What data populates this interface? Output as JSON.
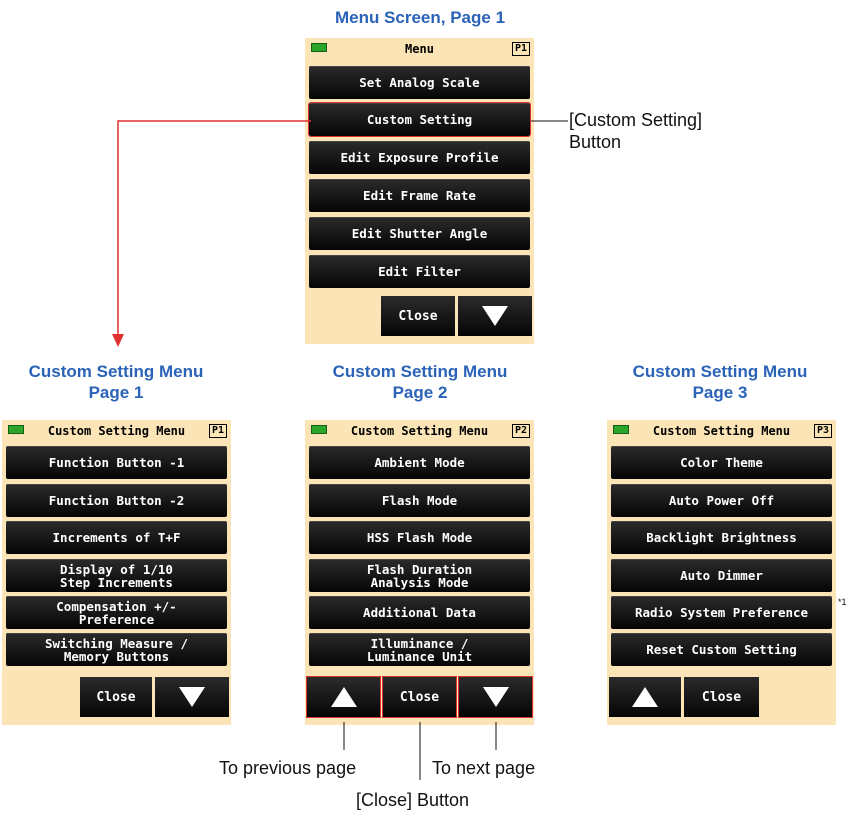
{
  "headings": {
    "menu_page1": "Menu Screen, Page 1",
    "cs_page1": [
      "Custom Setting Menu",
      "Page 1"
    ],
    "cs_page2": [
      "Custom Setting Menu",
      "Page 2"
    ],
    "cs_page3": [
      "Custom Setting Menu",
      "Page 3"
    ]
  },
  "menu_screen": {
    "title": "Menu",
    "page": "P1",
    "buttons": [
      "Set Analog Scale",
      "Custom Setting",
      "Edit Exposure Profile",
      "Edit Frame Rate",
      "Edit Shutter Angle",
      "Edit Filter"
    ],
    "close": "Close"
  },
  "cs1": {
    "title": "Custom Setting Menu",
    "page": "P1",
    "buttons": [
      "Function Button -1",
      "Function Button -2",
      "Increments of T+F",
      "Display of 1/10\nStep Increments",
      "Compensation +/-\nPreference",
      "Switching Measure /\nMemory Buttons"
    ],
    "close": "Close"
  },
  "cs2": {
    "title": "Custom Setting Menu",
    "page": "P2",
    "buttons": [
      "Ambient Mode",
      "Flash Mode",
      "HSS Flash Mode",
      "Flash Duration\nAnalysis Mode",
      "Additional Data",
      "Illuminance /\n  Luminance Unit"
    ],
    "close": "Close"
  },
  "cs3": {
    "title": "Custom Setting Menu",
    "page": "P3",
    "buttons": [
      "Color Theme",
      "Auto Power Off",
      "Backlight Brightness",
      "Auto Dimmer",
      "Radio System Preference",
      "Reset Custom Setting"
    ],
    "close": "Close"
  },
  "annotations": {
    "custom_setting_button": [
      "[Custom Setting]",
      "Button"
    ],
    "prev_page": "To previous page",
    "next_page": "To next page",
    "close_button": "[Close] Button",
    "footnote": "*1"
  },
  "colors": {
    "heading": "#2a63b8",
    "screen_bg": "#fbe4b6",
    "highlight": "#e03030",
    "battery": "#2ba62b"
  }
}
